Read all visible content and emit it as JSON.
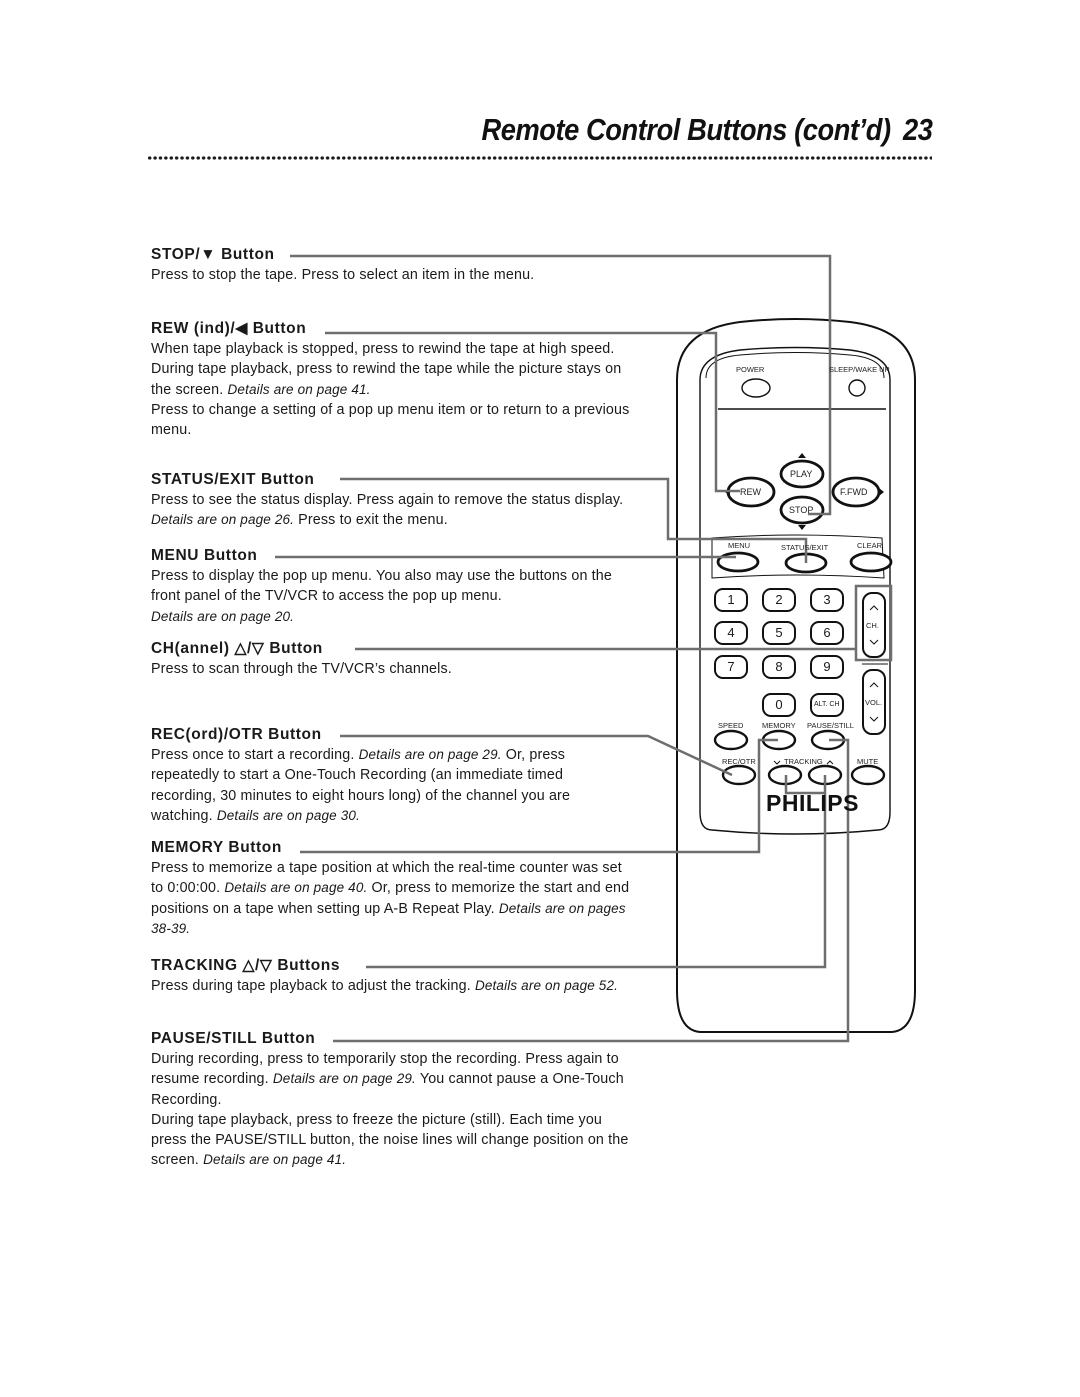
{
  "header": {
    "title": "Remote Control Buttons (cont’d)",
    "page_number": "23"
  },
  "sections": [
    {
      "heading": "STOP/▼ Button",
      "body": [
        {
          "text": "Press to stop the tape. Press to select an item in the menu.",
          "italic": false
        }
      ]
    },
    {
      "heading": "REW (ind)/◀ Button",
      "body": [
        {
          "text": "When tape playback is stopped, press to rewind the tape at high speed.  During tape playback, press to rewind the tape while the picture stays on the screen. ",
          "italic": false
        },
        {
          "text": "Details are on page 41.",
          "italic": true
        },
        {
          "text": "\nPress to change a setting of a pop up menu item or to return to a previous menu.",
          "italic": false
        }
      ]
    },
    {
      "heading": "STATUS/EXIT Button",
      "body": [
        {
          "text": "Press to see the status display. Press again to remove the status display. ",
          "italic": false
        },
        {
          "text": "Details are on page 26.",
          "italic": true
        },
        {
          "text": " Press to exit the menu.",
          "italic": false
        }
      ]
    },
    {
      "heading": "MENU Button",
      "body": [
        {
          "text": "Press to display the pop up menu. You also may use the buttons on the front panel of the TV/VCR to access the pop up menu.\n",
          "italic": false
        },
        {
          "text": "Details are on page 20.",
          "italic": true
        }
      ]
    },
    {
      "heading": "CH(annel) △/▽ Button",
      "body": [
        {
          "text": "Press to scan through the TV/VCR’s channels.",
          "italic": false
        }
      ]
    },
    {
      "heading": "REC(ord)/OTR Button",
      "body": [
        {
          "text": "Press once to start a recording. ",
          "italic": false
        },
        {
          "text": "Details are on page 29.",
          "italic": true
        },
        {
          "text": " Or, press repeatedly to start a One-Touch Recording (an immediate timed recording, 30 minutes to eight hours long) of the channel you are watching. ",
          "italic": false
        },
        {
          "text": "Details are on page 30.",
          "italic": true
        }
      ]
    },
    {
      "heading": "MEMORY Button",
      "body": [
        {
          "text": "Press to memorize a tape position at which the real-time counter was set to 0:00:00. ",
          "italic": false
        },
        {
          "text": "Details are on page 40.",
          "italic": true
        },
        {
          "text": " Or, press to memorize the start and end positions on a tape when setting up A-B Repeat Play. ",
          "italic": false
        },
        {
          "text": "Details are on pages 38-39.",
          "italic": true
        }
      ]
    },
    {
      "heading": "TRACKING △/▽ Buttons",
      "body": [
        {
          "text": "Press during tape playback to adjust the tracking. ",
          "italic": false
        },
        {
          "text": "Details are on page 52.",
          "italic": true
        }
      ]
    },
    {
      "heading": "PAUSE/STILL Button",
      "body": [
        {
          "text": "During recording, press to temporarily stop the recording. Press again to resume recording. ",
          "italic": false
        },
        {
          "text": "Details are on page 29.",
          "italic": true
        },
        {
          "text": " You cannot pause a One-Touch Recording.\nDuring tape playback, press to freeze the picture (still). Each time you press the PAUSE/STILL button, the noise lines will change position on the screen. ",
          "italic": false
        },
        {
          "text": "Details are on page 41.",
          "italic": true
        }
      ]
    }
  ],
  "remote": {
    "brand": "PHILIPS",
    "labels": {
      "power": "POWER",
      "sleep": "SLEEP/WAKE UP",
      "play": "PLAY",
      "rew": "REW",
      "ffwd": "F.FWD",
      "stop": "STOP",
      "menu": "MENU",
      "status_exit": "STATUS/EXIT",
      "clear": "CLEAR",
      "ch": "CH.",
      "vol": "VOL.",
      "alt_ch": "ALT. CH",
      "speed": "SPEED",
      "memory": "MEMORY",
      "pause_still": "PAUSE/STILL",
      "rec_otr": "REC/OTR",
      "tracking": "TRACKING",
      "mute": "MUTE"
    },
    "number_keys": [
      "1",
      "2",
      "3",
      "4",
      "5",
      "6",
      "7",
      "8",
      "9",
      "0"
    ]
  }
}
